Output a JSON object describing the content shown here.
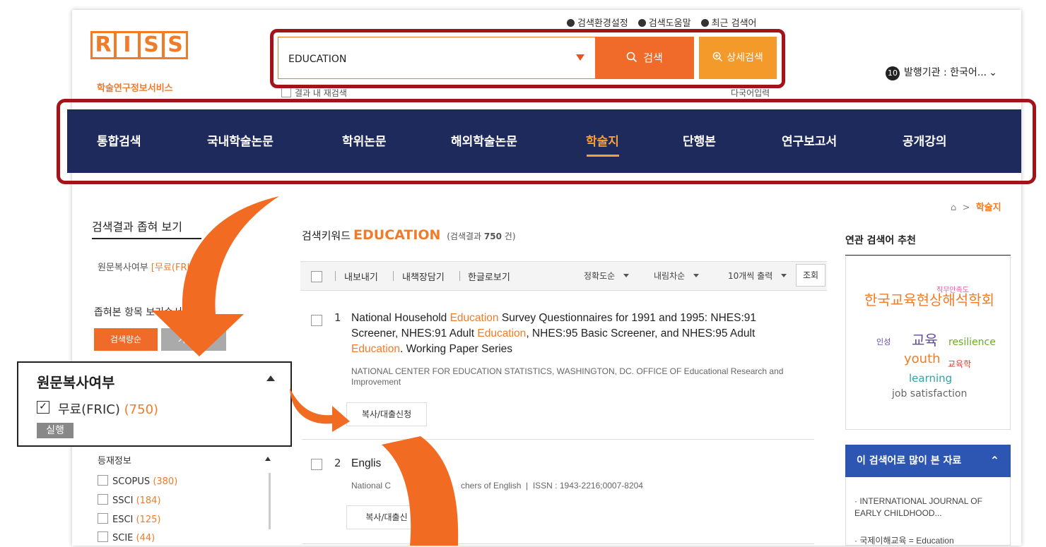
{
  "logo": {
    "letters": [
      "R",
      "I",
      "S",
      "S"
    ],
    "subtitle": "학술연구정보서비스"
  },
  "top_links": [
    "검색환경설정",
    "검색도움말",
    "최근 검색어"
  ],
  "search": {
    "value": "EDUCATION",
    "button_label": "검색",
    "advanced_label": "상세검색",
    "under_left": "결과 내 재검색",
    "under_right": "다국어입력"
  },
  "publisher": {
    "badge": "10",
    "label": "발행기관 : 한국어..."
  },
  "nav": {
    "items": [
      "통합검색",
      "국내학술논문",
      "학위논문",
      "해외학술논문",
      "학술지",
      "단행본",
      "연구보고서",
      "공개강의"
    ],
    "active": "학술지"
  },
  "breadcrumb": {
    "current": "학술지"
  },
  "sidebar": {
    "title": "검색결과 좁혀 보기",
    "filter_label": "원문복사여부",
    "filter_value": "[무료(FRIC)]",
    "order_title": "좁혀본 항목 보기순서",
    "order_buttons": [
      "검색량순",
      "가나다순"
    ],
    "zoom": {
      "title": "원문복사여부",
      "option_label": "무료(FRIC)",
      "option_count": "(750)",
      "run_label": "실행"
    },
    "registry_title": "등재정보",
    "registry_items": [
      {
        "name": "SCOPUS",
        "count": "(380)"
      },
      {
        "name": "SSCI",
        "count": "(184)"
      },
      {
        "name": "ESCI",
        "count": "(125)"
      },
      {
        "name": "SCIE",
        "count": "(44)"
      }
    ]
  },
  "results_header": {
    "prefix": "검색키워드",
    "keyword": "EDUCATION",
    "count_prefix": "(검색결과",
    "count": "750",
    "count_suffix": "건)"
  },
  "toolbar": {
    "actions": [
      "내보내기",
      "내책장담기",
      "한글로보기"
    ],
    "sort": "정확도순",
    "order": "내림차순",
    "per_page": "10개씩 출력",
    "view": "조회"
  },
  "results": [
    {
      "num": "1",
      "title_parts": [
        "National Household ",
        "Education",
        " Survey Questionnaires for 1991 and 1995: NHES:91 Screener, NHES:91 Adult ",
        "Education",
        ", NHES:95 Basic Screener, and NHES:95 Adult ",
        "Education",
        ". Working Paper Series"
      ],
      "publisher": "NATIONAL CENTER FOR EDUCATION STATISTICS, WASHINGTON, DC. OFFICE OF Educational Research and Improvement",
      "button": "복사/대출신청"
    },
    {
      "num": "2",
      "title": "Englis",
      "publisher_left": "National C",
      "publisher_right": "chers of English",
      "issn": "ISSN : 1943-2216;0007-8204",
      "button": "복사/대출신"
    }
  ],
  "related": {
    "title": "연관 검색어 추천",
    "words": [
      "직무만족도",
      "한국교육현상해석학회",
      "인성",
      "교육",
      "resilience",
      "youth",
      "교육학",
      "learning",
      "job satisfaction"
    ]
  },
  "most_viewed": {
    "title": "이 검색어로 많이 본 자료",
    "items": [
      "INTERNATIONAL JOURNAL OF EARLY CHILDHOOD...",
      "국제이해교육 = Education"
    ]
  },
  "colors": {
    "brand": "#f07c2a",
    "nav": "#1f2a5c",
    "highlight_frame": "#a31319",
    "accent_blue": "#2d56b3"
  }
}
